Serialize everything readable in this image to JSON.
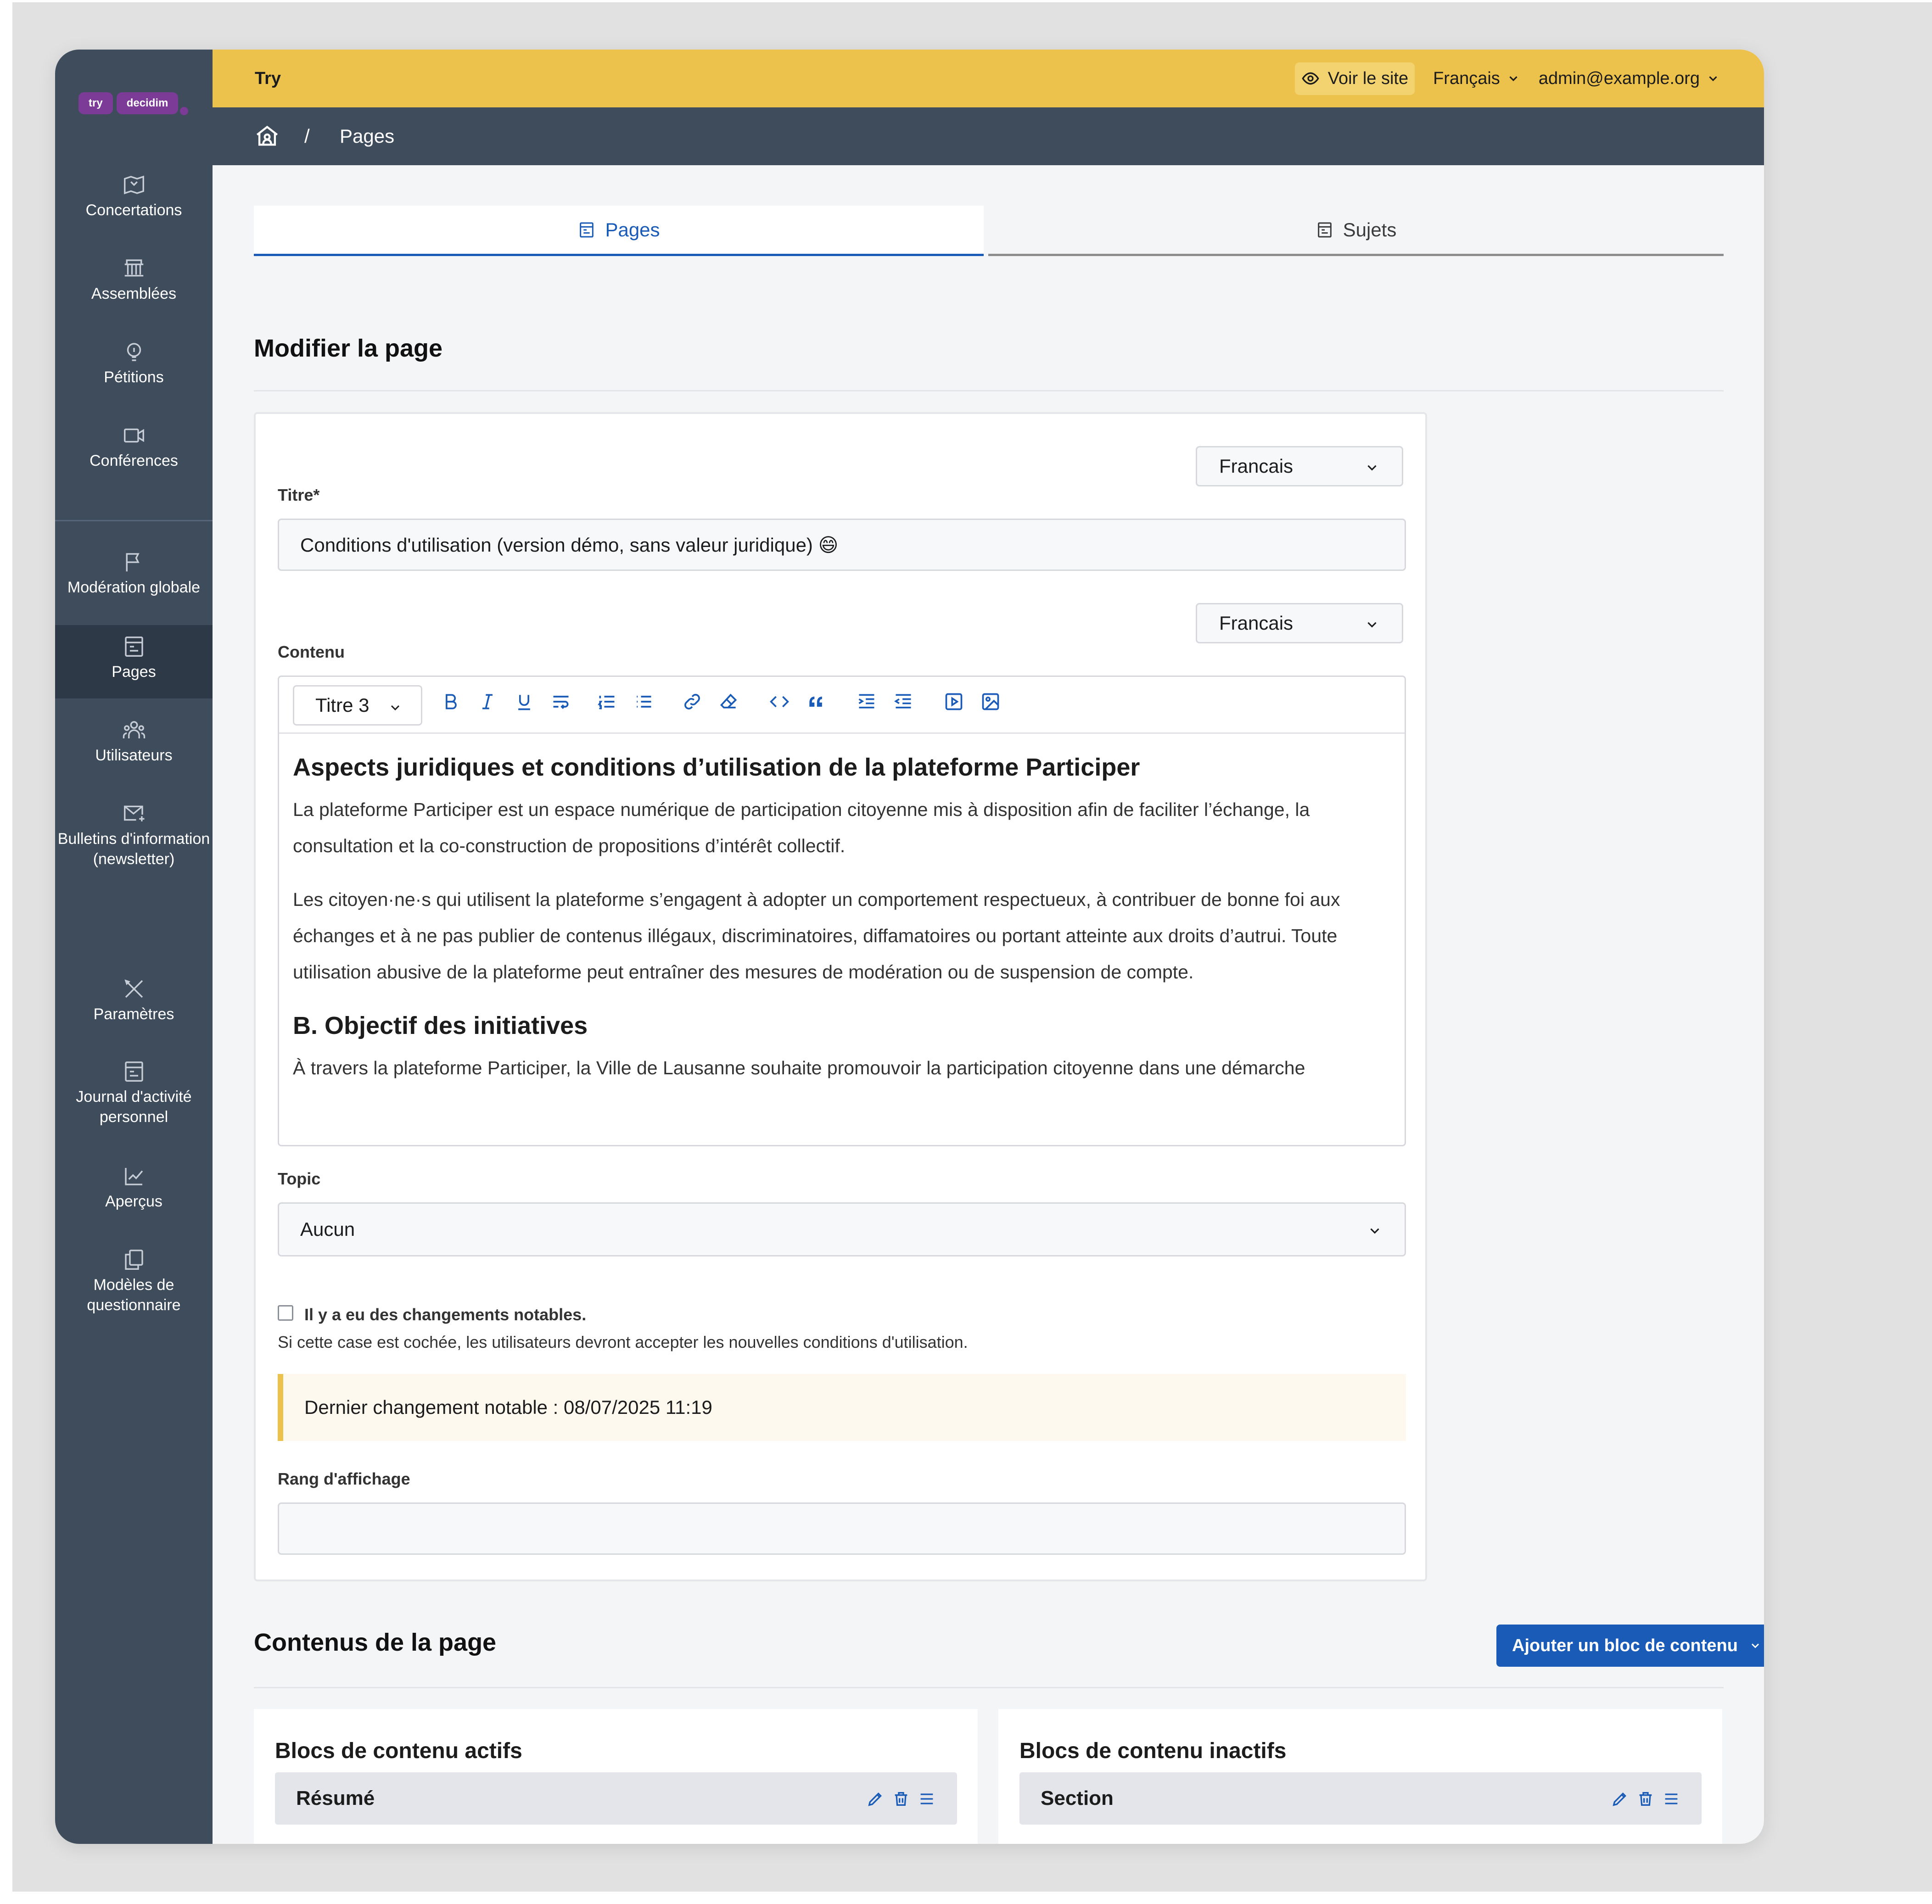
{
  "app": {
    "logo_left": "try",
    "logo_right": "decidim",
    "org_name": "Try",
    "view_site": "Voir le site",
    "language": "Français",
    "user_email": "admin@example.org"
  },
  "breadcrumb": {
    "current": "Pages",
    "separator": "/"
  },
  "sidebar": {
    "items": [
      {
        "label": "Concertations",
        "icon": "map-icon"
      },
      {
        "label": "Assemblées",
        "icon": "institution-icon"
      },
      {
        "label": "Pétitions",
        "icon": "lightbulb-icon"
      },
      {
        "label": "Conférences",
        "icon": "video-icon"
      },
      {
        "label": "Modération globale",
        "icon": "flag-icon"
      },
      {
        "label": "Pages",
        "icon": "page-icon"
      },
      {
        "label": "Utilisateurs",
        "icon": "users-icon"
      },
      {
        "label": "Bulletins d'information (newsletter)",
        "icon": "mail-icon"
      },
      {
        "label": "Paramètres",
        "icon": "tools-icon"
      },
      {
        "label": "Journal d'activité personnel",
        "icon": "log-icon"
      },
      {
        "label": "Aperçus",
        "icon": "chart-icon"
      },
      {
        "label": "Modèles de questionnaire",
        "icon": "copy-icon"
      }
    ]
  },
  "tabs": {
    "pages": "Pages",
    "topics": "Sujets"
  },
  "form": {
    "heading": "Modifier la page",
    "title_lang": "Francais",
    "title_label": "Titre*",
    "title_value": "Conditions d'utilisation (version démo, sans valeur juridique) 😄",
    "content_lang": "Francais",
    "content_label": "Contenu",
    "heading_select": "Titre 3",
    "content": {
      "h1": "Aspects juridiques et conditions d’utilisation de la plateforme Participer",
      "p1": "La plateforme Participer est un espace numérique de participation citoyenne mis à disposition afin de faciliter l’échange, la consultation et la co-construction de propositions d’intérêt collectif.",
      "p2": "Les citoyen·ne·s qui utilisent la plateforme s’engagent à adopter un comportement respectueux, à contribuer de bonne foi aux échanges et à ne pas publier de contenus illégaux, discriminatoires, diffamatoires ou portant atteinte aux droits d’autrui. Toute utilisation abusive de la plateforme peut entraîner des mesures de modération ou de suspension de compte.",
      "h2": "B. Objectif des initiatives",
      "p3": "À travers la plateforme Participer, la Ville de Lausanne souhaite promouvoir la participation citoyenne dans une démarche"
    },
    "topic_label": "Topic",
    "topic_value": "Aucun",
    "checkbox_label": "Il y a eu des changements notables.",
    "checkbox_help": "Si cette case est cochée, les utilisateurs devront accepter les nouvelles conditions d'utilisation.",
    "last_change": "Dernier changement notable : 08/07/2025 11:19",
    "rank_label": "Rang d'affichage",
    "rank_value": ""
  },
  "contents": {
    "heading": "Contenus de la page",
    "add_button": "Ajouter un bloc de contenu",
    "active_title": "Blocs de contenu actifs",
    "active_block": "Résumé",
    "inactive_title": "Blocs de contenu inactifs",
    "inactive_block": "Section"
  },
  "colors": {
    "topbar": "#ecc24c",
    "sidebar": "#3e4c5c",
    "accent": "#1a5bb8"
  }
}
